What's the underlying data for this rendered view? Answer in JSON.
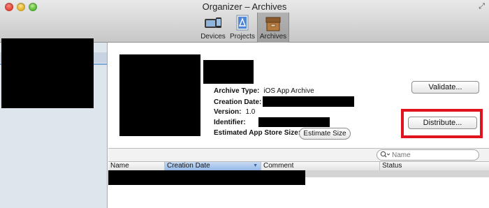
{
  "window": {
    "title": "Organizer – Archives"
  },
  "toolbar": {
    "items": [
      {
        "label": "Devices",
        "icon": "devices-icon"
      },
      {
        "label": "Projects",
        "icon": "projects-icon"
      },
      {
        "label": "Archives",
        "icon": "archives-icon",
        "selected": true
      }
    ]
  },
  "archive": {
    "type_label": "Archive Type:",
    "type_value": "iOS App Archive",
    "creation_date_label": "Creation Date:",
    "version_label": "Version:",
    "version_value": "1.0",
    "identifier_label": "Identifier:",
    "size_label": "Estimated App Store Size:",
    "estimate_button": "Estimate Size"
  },
  "actions": {
    "validate_label": "Validate...",
    "distribute_label": "Distribute..."
  },
  "search": {
    "placeholder": "Name"
  },
  "table": {
    "columns": [
      {
        "label": "Name"
      },
      {
        "label": "Creation Date",
        "sorted": true
      },
      {
        "label": "Comment"
      },
      {
        "label": "Status"
      }
    ]
  },
  "colors": {
    "highlight": "#e0141e",
    "sidebar": "#dfe5ec",
    "sorted_header": "#94b8e6"
  }
}
